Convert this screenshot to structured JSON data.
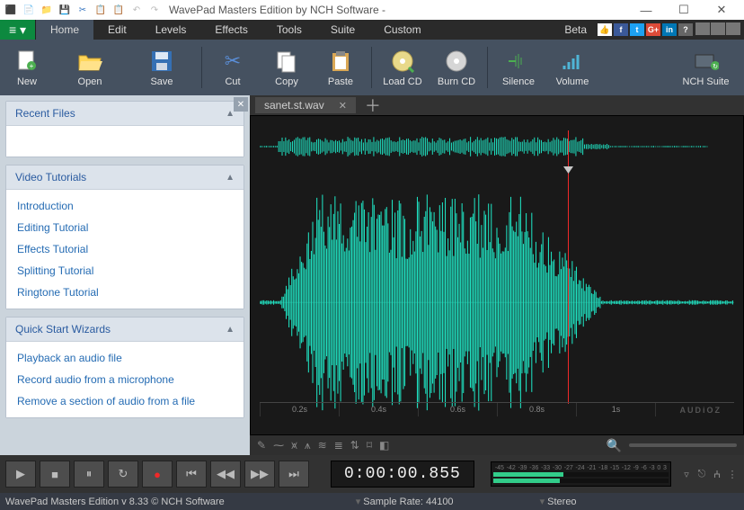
{
  "window": {
    "title": "WavePad Masters Edition by NCH Software -"
  },
  "menu": {
    "tabs": [
      "Home",
      "Edit",
      "Levels",
      "Effects",
      "Tools",
      "Suite",
      "Custom"
    ],
    "beta": "Beta"
  },
  "ribbon": {
    "new": "New",
    "open": "Open",
    "save": "Save",
    "cut": "Cut",
    "copy": "Copy",
    "paste": "Paste",
    "loadcd": "Load CD",
    "burncd": "Burn CD",
    "silence": "Silence",
    "volume": "Volume",
    "suite": "NCH Suite"
  },
  "sidebar": {
    "recent": {
      "title": "Recent Files"
    },
    "tutorials": {
      "title": "Video Tutorials",
      "items": [
        "Introduction",
        "Editing Tutorial",
        "Effects Tutorial",
        "Splitting Tutorial",
        "Ringtone Tutorial"
      ]
    },
    "wizards": {
      "title": "Quick Start Wizards",
      "items": [
        "Playback an audio file",
        "Record audio from a microphone",
        "Remove a section of audio from a file"
      ]
    }
  },
  "file": {
    "name": "sanet.st.wav"
  },
  "timeline": {
    "marks": [
      "0.2s",
      "0.4s",
      "0.6s",
      "0.8s",
      "1s"
    ]
  },
  "transport": {
    "timecode": "0:00:00.855"
  },
  "meter": {
    "labels": [
      "-45",
      "-42",
      "-39",
      "-36",
      "-33",
      "-30",
      "-27",
      "-24",
      "-21",
      "-18",
      "-15",
      "-12",
      "-9",
      "-6",
      "-3",
      "0",
      "3"
    ]
  },
  "status": {
    "version": "WavePad Masters Edition v 8.33 © NCH Software",
    "samplerate": "Sample Rate: 44100",
    "channels": "Stereo"
  },
  "watermark": "AUDiOZ"
}
